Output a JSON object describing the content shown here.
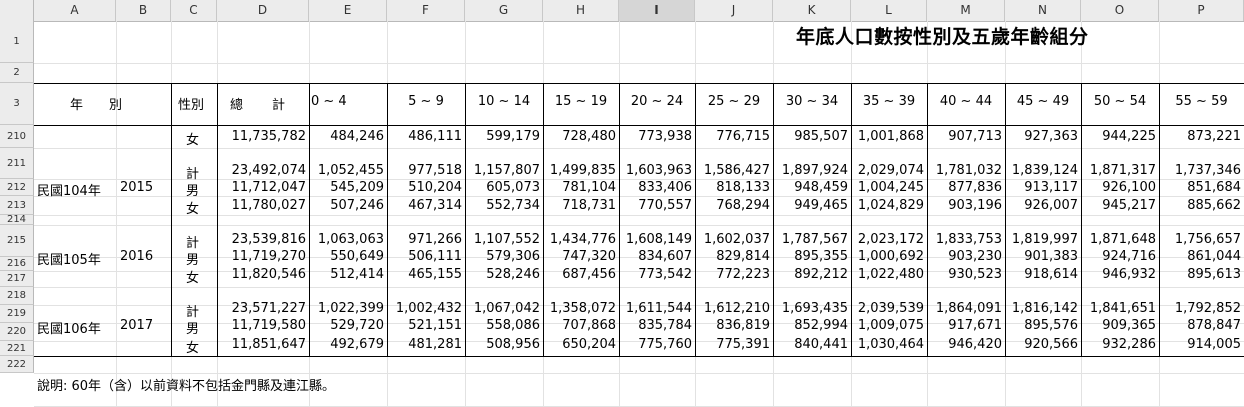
{
  "columns": [
    "A",
    "B",
    "C",
    "D",
    "E",
    "F",
    "G",
    "H",
    "I",
    "J",
    "K",
    "L",
    "M",
    "N",
    "O",
    "P"
  ],
  "selected_column": "I",
  "title": "年底人口數按性別及五歲年齡組分",
  "header": {
    "year": "年　　別",
    "sex": "性別",
    "total": "總　　計",
    "age_groups": [
      "0 ~ 4",
      "5 ~ 9",
      "10 ~ 14",
      "15 ~ 19",
      "20 ~ 24",
      "25 ~ 29",
      "30 ~ 34",
      "35 ~ 39",
      "40 ~ 44",
      "45 ~ 49",
      "50 ~ 54",
      "55 ~ 59"
    ]
  },
  "row_numbers": [
    "1",
    "2",
    "3",
    "210",
    "211",
    "212",
    "213",
    "214",
    "215",
    "216",
    "217",
    "218",
    "219",
    "220",
    "221",
    "222"
  ],
  "data_rows": [
    {
      "row": "210",
      "roc": "",
      "year": "",
      "sex": "女",
      "values": [
        "11,735,782",
        "484,246",
        "486,111",
        "599,179",
        "728,480",
        "773,938",
        "776,715",
        "985,507",
        "1,001,868",
        "907,713",
        "927,363",
        "944,225",
        "873,221"
      ]
    },
    {
      "row": "211",
      "roc": "",
      "year": "",
      "sex": "計",
      "values": [
        "23,492,074",
        "1,052,455",
        "977,518",
        "1,157,807",
        "1,499,835",
        "1,603,963",
        "1,586,427",
        "1,897,924",
        "2,029,074",
        "1,781,032",
        "1,839,124",
        "1,871,317",
        "1,737,346"
      ]
    },
    {
      "row": "212",
      "roc": "民國104年",
      "year": "2015",
      "sex": "男",
      "values": [
        "11,712,047",
        "545,209",
        "510,204",
        "605,073",
        "781,104",
        "833,406",
        "818,133",
        "948,459",
        "1,004,245",
        "877,836",
        "913,117",
        "926,100",
        "851,684"
      ]
    },
    {
      "row": "213",
      "roc": "",
      "year": "",
      "sex": "女",
      "values": [
        "11,780,027",
        "507,246",
        "467,314",
        "552,734",
        "718,731",
        "770,557",
        "768,294",
        "949,465",
        "1,024,829",
        "903,196",
        "926,007",
        "945,217",
        "885,662"
      ]
    },
    {
      "row": "214",
      "roc": "",
      "year": "",
      "sex": "計",
      "values": [
        "23,539,816",
        "1,063,063",
        "971,266",
        "1,107,552",
        "1,434,776",
        "1,608,149",
        "1,602,037",
        "1,787,567",
        "2,023,172",
        "1,833,753",
        "1,819,997",
        "1,871,648",
        "1,756,657"
      ]
    },
    {
      "row": "215",
      "roc": "民國105年",
      "year": "2016",
      "sex": "男",
      "values": [
        "11,719,270",
        "550,649",
        "506,111",
        "579,306",
        "747,320",
        "834,607",
        "829,814",
        "895,355",
        "1,000,692",
        "903,230",
        "901,383",
        "924,716",
        "861,044"
      ]
    },
    {
      "row": "216",
      "roc": "",
      "year": "",
      "sex": "女",
      "values": [
        "11,820,546",
        "512,414",
        "465,155",
        "528,246",
        "687,456",
        "773,542",
        "772,223",
        "892,212",
        "1,022,480",
        "930,523",
        "918,614",
        "946,932",
        "895,613"
      ]
    },
    {
      "row": "217",
      "roc": "",
      "year": "",
      "sex": "計",
      "values": [
        "23,571,227",
        "1,022,399",
        "1,002,432",
        "1,067,042",
        "1,358,072",
        "1,611,544",
        "1,612,210",
        "1,693,435",
        "2,039,539",
        "1,864,091",
        "1,816,142",
        "1,841,651",
        "1,792,852"
      ]
    },
    {
      "row": "218",
      "roc": "民國106年",
      "year": "2017",
      "sex": "男",
      "values": [
        "11,719,580",
        "529,720",
        "521,151",
        "558,086",
        "707,868",
        "835,784",
        "836,819",
        "852,994",
        "1,009,075",
        "917,671",
        "895,576",
        "909,365",
        "878,847"
      ]
    },
    {
      "row": "219",
      "roc": "",
      "year": "",
      "sex": "女",
      "values": [
        "11,851,647",
        "492,679",
        "481,281",
        "508,956",
        "650,204",
        "775,760",
        "775,391",
        "840,441",
        "1,030,464",
        "946,420",
        "920,566",
        "932,286",
        "914,005"
      ]
    }
  ],
  "note": "說明:  60年（含）以前資料不包括金門縣及連江縣。"
}
